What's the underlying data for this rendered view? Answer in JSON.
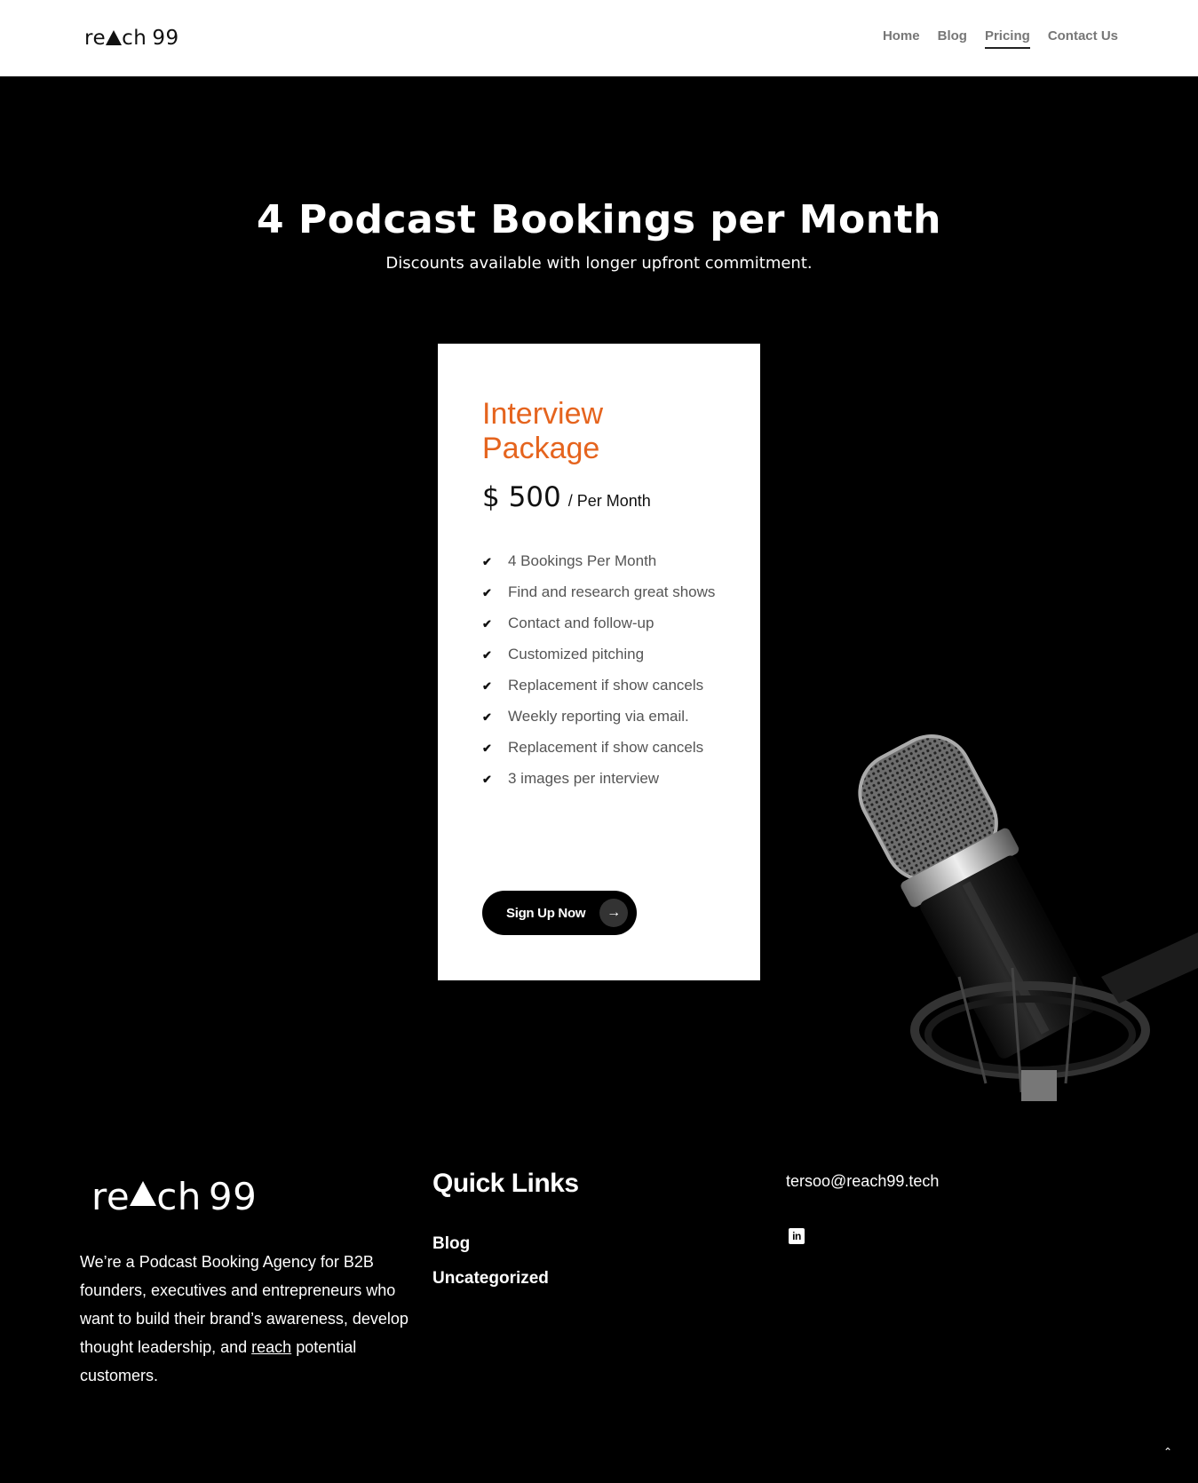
{
  "header": {
    "logo": {
      "text_left": "re",
      "text_mid": "ch",
      "text_right": "99"
    },
    "nav": [
      {
        "label": "Home"
      },
      {
        "label": "Blog"
      },
      {
        "label": "Pricing",
        "active": true
      },
      {
        "label": "Contact Us"
      }
    ]
  },
  "hero": {
    "title": "4 Podcast Bookings per Month",
    "subtitle": "Discounts available with longer upfront commitment."
  },
  "pricing_card": {
    "name": "Interview Package",
    "price": "$ 500",
    "period": "/ Per Month",
    "features": [
      "4 Bookings Per Month",
      "Find and research great shows",
      "Contact and follow-up",
      "Customized pitching",
      "Replacement if show cancels",
      "Weekly reporting via email.",
      "Replacement if show cancels",
      "3 images per interview"
    ],
    "cta_label": "Sign Up Now",
    "accent_color": "#e5641e"
  },
  "footer": {
    "about_before": "We’re a Podcast Booking Agency for B2B founders, executives and entrepreneurs who want to build their brand’s awareness, develop thought leadership, and ",
    "about_link": "reach",
    "about_after": " potential customers.",
    "quick_links_title": "Quick Links",
    "quick_links": [
      "Blog",
      "Uncategorized"
    ],
    "email": "tersoo@reach99.tech",
    "social_icon": "linkedin-icon",
    "linkedin_glyph": "in"
  },
  "icons": {
    "check": "✔",
    "arrow": "→",
    "to_top": "⌃"
  }
}
